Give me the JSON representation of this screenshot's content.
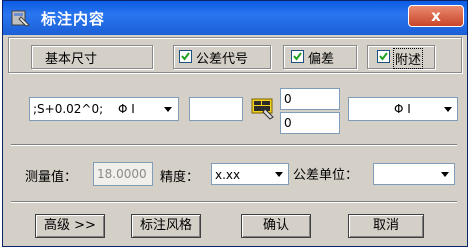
{
  "window": {
    "title": "标注内容",
    "close_label": "x",
    "icon": "app-icon"
  },
  "options": {
    "basic_size_label": "基本尺寸",
    "tolerance_code": {
      "label": "公差代号",
      "checked": true
    },
    "deviation": {
      "label": "偏差",
      "checked": true
    },
    "note": {
      "label": "附述",
      "checked": true
    }
  },
  "row": {
    "expression_value": ";S+0.02^0;",
    "symbol_select_value": "Φ I",
    "text_box_value": "",
    "icon_button": "deviation-edit-icon",
    "upper_deviation_value": "0",
    "lower_deviation_value": "0",
    "right_text_value": "",
    "right_select_value": "Φ I"
  },
  "measure": {
    "value_label": "测量值：",
    "value": "18.0000",
    "precision_label": "精度：",
    "precision_value": "x.xx",
    "unit_label": "公差单位：",
    "unit_value": ""
  },
  "buttons": {
    "advanced": "高级 >>",
    "style": "标注风格",
    "ok": "确认",
    "cancel": "取消"
  },
  "colors": {
    "titlebar": "#1a5fd6",
    "dialog_bg": "#d4d0c8"
  }
}
